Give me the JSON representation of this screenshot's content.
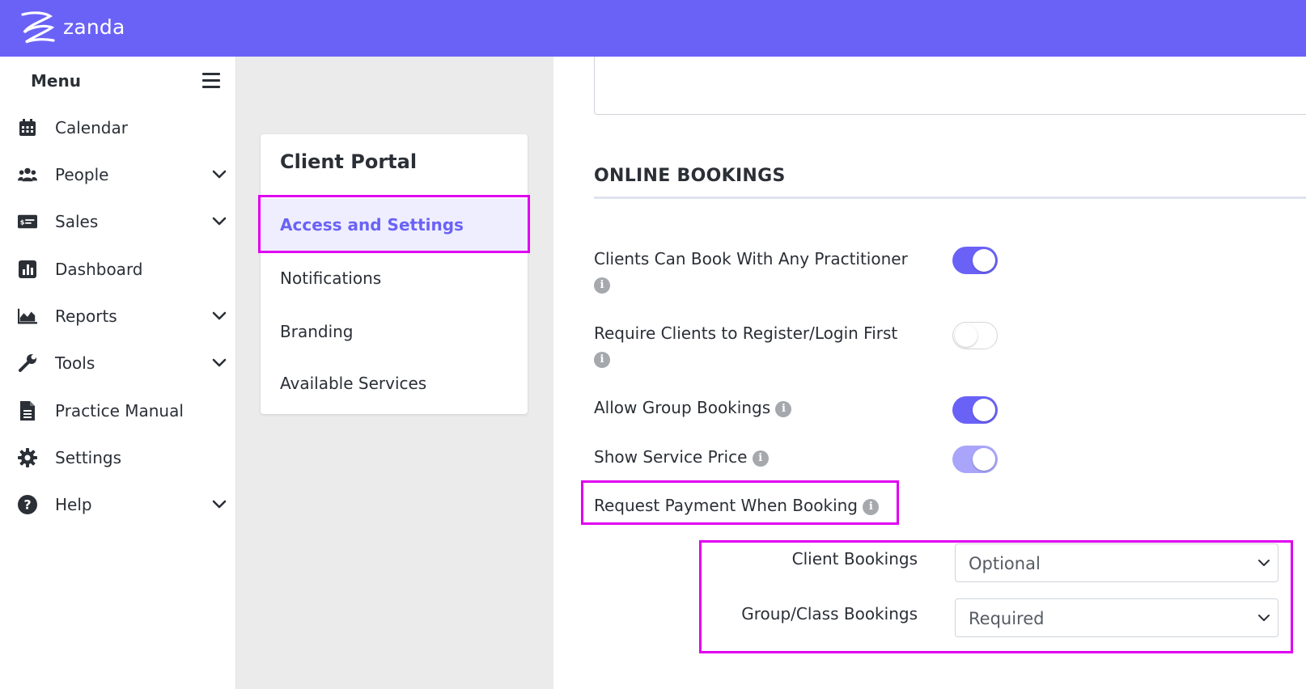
{
  "brand": {
    "name": "zanda",
    "color": "#6a62f7"
  },
  "sidebar": {
    "title": "Menu",
    "items": [
      {
        "label": "Calendar",
        "icon": "calendar-icon",
        "expandable": false
      },
      {
        "label": "People",
        "icon": "people-icon",
        "expandable": true
      },
      {
        "label": "Sales",
        "icon": "sales-icon",
        "expandable": true
      },
      {
        "label": "Dashboard",
        "icon": "dashboard-icon",
        "expandable": false
      },
      {
        "label": "Reports",
        "icon": "reports-icon",
        "expandable": true
      },
      {
        "label": "Tools",
        "icon": "wrench-icon",
        "expandable": true
      },
      {
        "label": "Practice Manual",
        "icon": "document-icon",
        "expandable": false
      },
      {
        "label": "Settings",
        "icon": "gear-icon",
        "expandable": false
      },
      {
        "label": "Help",
        "icon": "help-icon",
        "expandable": true
      }
    ]
  },
  "portal": {
    "title": "Client Portal",
    "links": [
      {
        "label": "Access and Settings",
        "active": true
      },
      {
        "label": "Notifications",
        "active": false
      },
      {
        "label": "Branding",
        "active": false
      },
      {
        "label": "Available Services",
        "active": false
      }
    ]
  },
  "online_bookings": {
    "title": "ONLINE BOOKINGS",
    "settings": [
      {
        "label": "Clients Can Book With Any Practitioner",
        "state": "on"
      },
      {
        "label": "Require Clients to Register/Login First",
        "state": "off"
      },
      {
        "label": "Allow Group Bookings",
        "state": "on"
      },
      {
        "label": "Show Service Price",
        "state": "dim"
      }
    ],
    "payment": {
      "label": "Request Payment When Booking",
      "client_label": "Client Bookings",
      "client_value": "Optional",
      "group_label": "Group/Class Bookings",
      "group_value": "Required"
    }
  },
  "colors": {
    "highlight": "#e000f0",
    "toggle_on": "#6a62f7"
  }
}
